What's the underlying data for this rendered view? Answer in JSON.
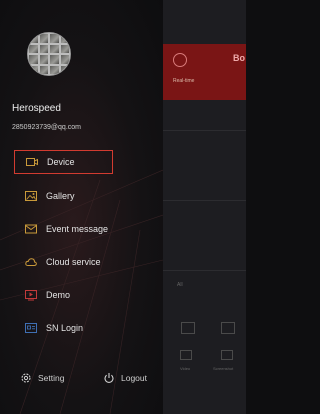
{
  "profile": {
    "username": "Herospeed",
    "email": "2850923739@qq.com"
  },
  "menu": [
    {
      "label": "Device",
      "icon": "camera-icon",
      "color": "#c99a3a",
      "selected": true
    },
    {
      "label": "Gallery",
      "icon": "gallery-icon",
      "color": "#c99a3a",
      "selected": false
    },
    {
      "label": "Event message",
      "icon": "message-icon",
      "color": "#c99a3a",
      "selected": false
    },
    {
      "label": "Cloud service",
      "icon": "cloud-icon",
      "color": "#c99a3a",
      "selected": false
    },
    {
      "label": "Demo",
      "icon": "demo-icon",
      "color": "#c23a3a",
      "selected": false
    },
    {
      "label": "SN Login",
      "icon": "sn-login-icon",
      "color": "#3f6fb3",
      "selected": false
    }
  ],
  "footer": {
    "setting_label": "Setting",
    "logout_label": "Logout"
  },
  "background_app": {
    "title": "Bo",
    "subtitle": "Real-time",
    "item": "All",
    "tab_labels": [
      "Video",
      "Screenshot"
    ]
  },
  "colors": {
    "accent_red": "#d23b30",
    "header_red": "#7a1515"
  }
}
